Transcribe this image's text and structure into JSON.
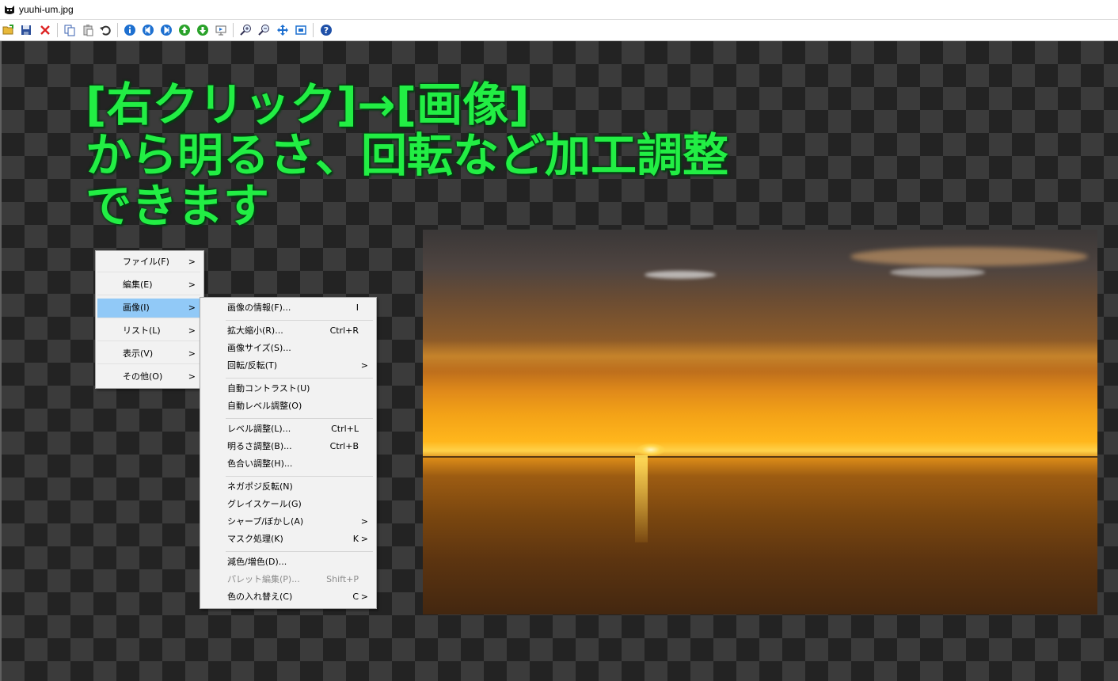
{
  "window": {
    "title": "yuuhi-um.jpg"
  },
  "toolbar": {
    "icons": [
      "open-folder-icon",
      "save-icon",
      "delete-icon",
      "copy-icon",
      "paste-icon",
      "undo-icon",
      "info-icon",
      "prev-icon",
      "next-icon",
      "up-icon",
      "down-icon",
      "slideshow-icon",
      "zoom-in-icon",
      "zoom-out-icon",
      "fit-icon",
      "fullscreen-icon",
      "help-icon"
    ]
  },
  "overlay": {
    "line1": "[右クリック]→[画像]",
    "line2": "から明るさ、回転など加工調整",
    "line3": "できます",
    "color": "#22ee44"
  },
  "context_menu": {
    "items": [
      {
        "label": "ファイル(F)"
      },
      {
        "label": "編集(E)"
      },
      {
        "label": "画像(I)",
        "active": true
      },
      {
        "label": "リスト(L)"
      },
      {
        "label": "表示(V)"
      },
      {
        "label": "その他(O)"
      }
    ],
    "highlight_color": "#91c9f7"
  },
  "image_submenu": {
    "items": [
      {
        "label": "画像の情報(F)...",
        "shortcut": "I"
      },
      {
        "label": "拡大縮小(R)...",
        "shortcut": "Ctrl+R"
      },
      {
        "label": "画像サイズ(S)..."
      },
      {
        "label": "回転/反転(T)"
      },
      {
        "label": "自動コントラスト(U)"
      },
      {
        "label": "自動レベル調整(O)"
      },
      {
        "label": "レベル調整(L)...",
        "shortcut": "Ctrl+L"
      },
      {
        "label": "明るさ調整(B)...",
        "shortcut": "Ctrl+B"
      },
      {
        "label": "色合い調整(H)..."
      },
      {
        "label": "ネガポジ反転(N)"
      },
      {
        "label": "グレイスケール(G)"
      },
      {
        "label": "シャープ/ぼかし(A)"
      },
      {
        "label": "マスク処理(K)",
        "shortcut": "K"
      },
      {
        "label": "減色/増色(D)..."
      },
      {
        "label": "パレット編集(P)...",
        "shortcut": "Shift+P",
        "disabled": true
      },
      {
        "label": "色の入れ替え(C)",
        "shortcut": "C"
      }
    ]
  }
}
